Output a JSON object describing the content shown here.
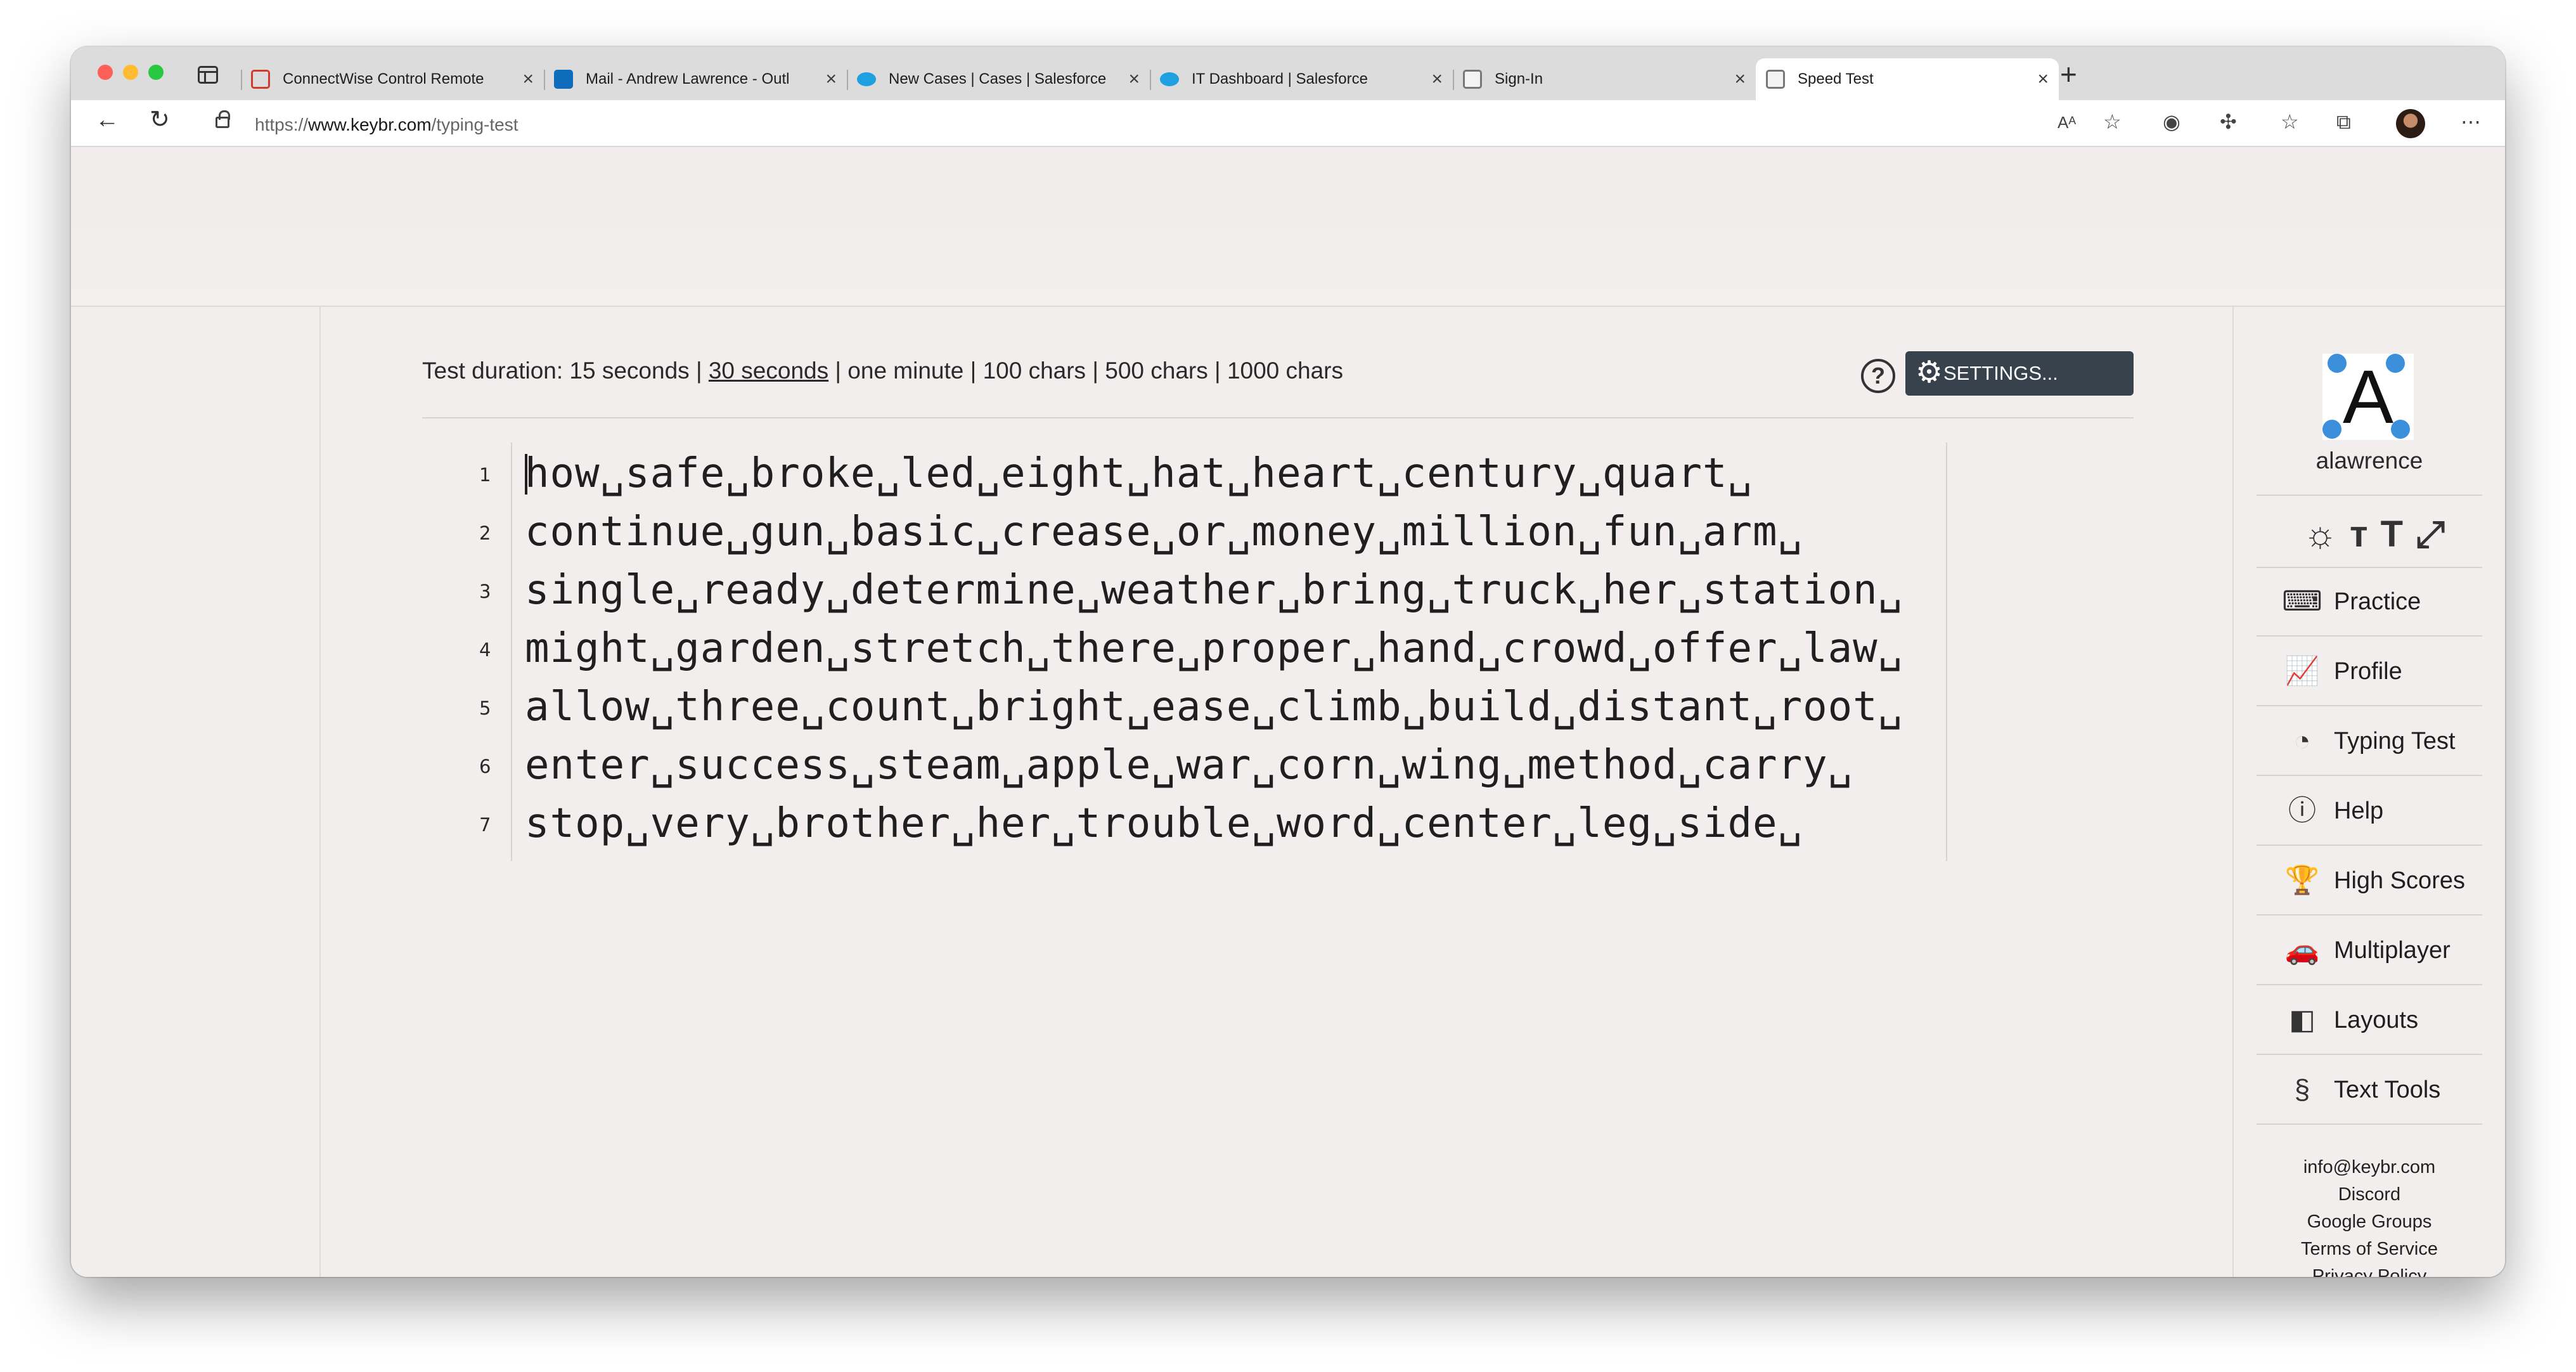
{
  "browser": {
    "tabs": [
      {
        "title": "ConnectWise Control Remote",
        "favicon": "connectwise-icon"
      },
      {
        "title": "Mail - Andrew Lawrence - Outl",
        "favicon": "outlook-icon"
      },
      {
        "title": "New Cases | Cases | Salesforce",
        "favicon": "salesforce-icon"
      },
      {
        "title": "IT Dashboard | Salesforce",
        "favicon": "salesforce-icon"
      },
      {
        "title": "Sign-In",
        "favicon": "document-icon"
      },
      {
        "title": "Speed Test",
        "favicon": "document-icon"
      }
    ],
    "close_glyph": "×",
    "new_tab_glyph": "+",
    "url_prefix": "https://",
    "url_domain": "www.keybr.com",
    "url_path": "/typing-test"
  },
  "test": {
    "duration_label": "Test duration:",
    "opt_15": "15 seconds",
    "opt_30": "30 seconds",
    "opt_60": "one minute",
    "opt_100": "100 chars",
    "opt_500": "500 chars",
    "opt_1000": "1000 chars",
    "sep": "|",
    "help_glyph": "?",
    "settings_label": "SETTINGS..."
  },
  "lines": [
    {
      "num": "1",
      "text": "how␣safe␣broke␣led␣eight␣hat␣heart␣century␣quart␣"
    },
    {
      "num": "2",
      "text": "continue␣gun␣basic␣crease␣or␣money␣million␣fun␣arm␣"
    },
    {
      "num": "3",
      "text": "single␣ready␣determine␣weather␣bring␣truck␣her␣station␣"
    },
    {
      "num": "4",
      "text": "might␣garden␣stretch␣there␣proper␣hand␣crowd␣offer␣law␣"
    },
    {
      "num": "5",
      "text": "allow␣three␣count␣bright␣ease␣climb␣build␣distant␣root␣"
    },
    {
      "num": "6",
      "text": "enter␣success␣steam␣apple␣war␣corn␣wing␣method␣carry␣"
    },
    {
      "num": "7",
      "text": "stop␣very␣brother␣her␣trouble␣word␣center␣leg␣side␣"
    }
  ],
  "sidebar": {
    "avatar_letter": "A",
    "username": "alawrence",
    "nav": [
      {
        "label": "Practice",
        "icon": "keyboard-icon"
      },
      {
        "label": "Profile",
        "icon": "chart-icon"
      },
      {
        "label": "Typing Test",
        "icon": "speedometer-icon"
      },
      {
        "label": "Help",
        "icon": "help-icon"
      },
      {
        "label": "High Scores",
        "icon": "trophy-icon"
      },
      {
        "label": "Multiplayer",
        "icon": "car-icon"
      },
      {
        "label": "Layouts",
        "icon": "layouts-icon"
      },
      {
        "label": "Text Tools",
        "icon": "section-icon"
      }
    ],
    "footer": [
      "info@keybr.com",
      "Discord",
      "Google Groups",
      "Terms of Service",
      "Privacy Policy"
    ]
  },
  "colors": {
    "accent_button": "#37424d",
    "avatar_dots": "#3b8fdb",
    "page_bg": "#f1eeed"
  }
}
